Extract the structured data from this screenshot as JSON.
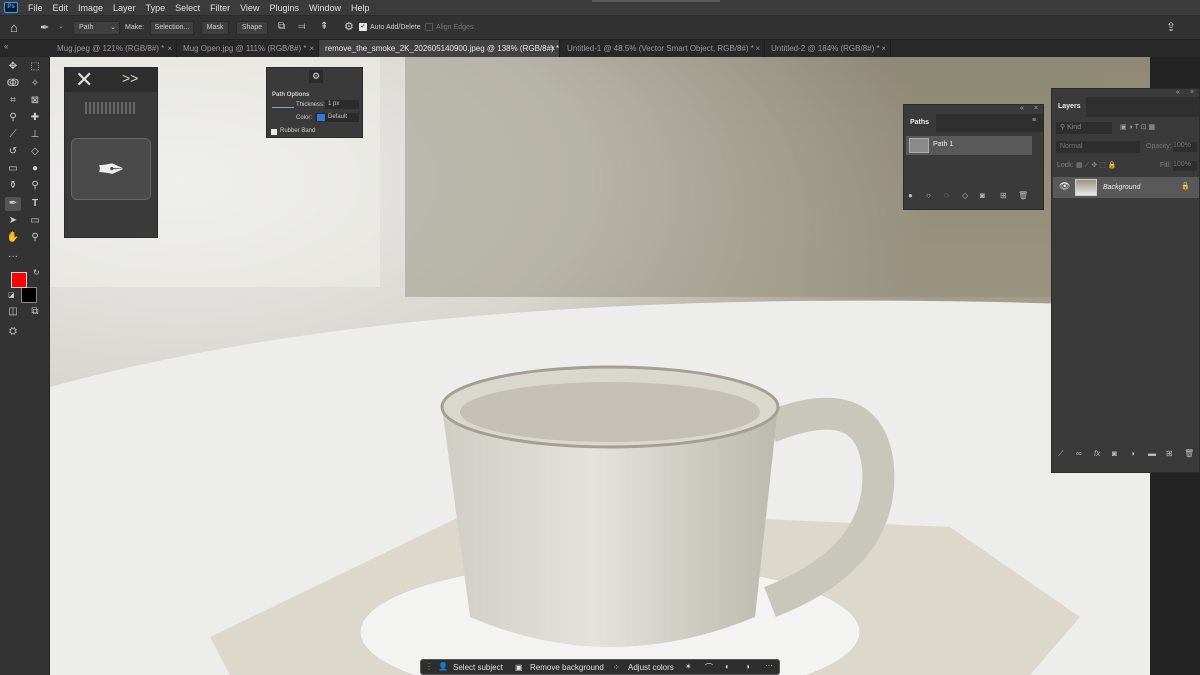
{
  "menubar": {
    "logo": "Ps",
    "items": [
      "File",
      "Edit",
      "Image",
      "Layer",
      "Type",
      "Select",
      "Filter",
      "View",
      "Plugins",
      "Window",
      "Help"
    ]
  },
  "options": {
    "tool_mode": "Path",
    "make_label": "Make:",
    "selection_label": "Selection...",
    "mask_label": "Mask",
    "shape_label": "Shape",
    "auto_add_delete": "Auto Add/Delete",
    "align_edges": "Align Edges"
  },
  "tabs": [
    {
      "label": "Mug.jpeg @ 121% (RGB/8#) *",
      "active": false
    },
    {
      "label": "Mug Open.jpg @ 111% (RGB/8#) *",
      "active": false
    },
    {
      "label": "remove_the_smoke_2K_202605140900.jpeg @ 138% (RGB/8#) *",
      "active": true
    },
    {
      "label": "Untitled-1 @ 48.5% (Vector Smart Object, RGB/8#) *",
      "active": false
    },
    {
      "label": "Untitled-2 @ 184% (RGB/8#) *",
      "active": false
    }
  ],
  "path_options": {
    "title": "Path Options",
    "thickness_label": "Thickness:",
    "thickness_value": "1 px",
    "color_label": "Color:",
    "color_value": "Default",
    "rubber_band": "Rubber Band"
  },
  "paths_panel": {
    "title": "Paths",
    "items": [
      "Path 1"
    ]
  },
  "layers_panel": {
    "title": "Layers",
    "filter": "Kind",
    "blend": "Normal",
    "opacity_label": "Opacity:",
    "opacity_value": "100%",
    "lock_label": "Lock:",
    "fill_label": "Fill:",
    "fill_value": "100%",
    "layers": [
      "Background"
    ]
  },
  "context_bar": {
    "select_subject": "Select subject",
    "remove_background": "Remove background",
    "adjust_colors": "Adjust colors"
  },
  "colors": {
    "foreground": "#ff0000",
    "background": "#000000"
  }
}
